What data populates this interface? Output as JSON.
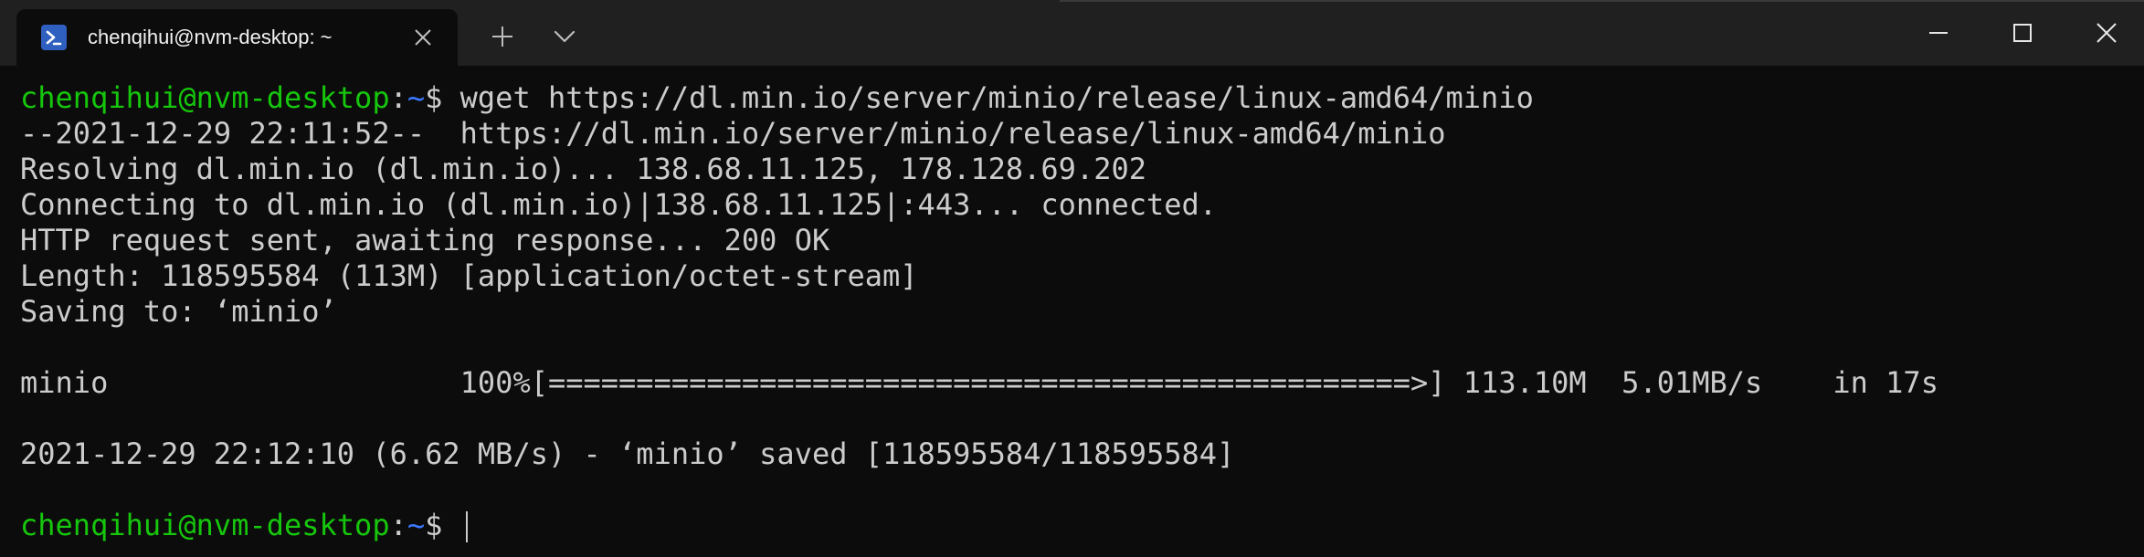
{
  "titlebar": {
    "tab_title": "chenqihui@nvm-desktop: ~",
    "tab_icon": "powershell-icon",
    "new_tab_icon": "plus-icon",
    "dropdown_icon": "chevron-down-icon",
    "minimize_icon": "minimize-icon",
    "maximize_icon": "maximize-icon",
    "close_icon": "close-icon"
  },
  "colors": {
    "prompt_user": "#16c60c",
    "prompt_path": "#3b78ff",
    "text": "#cccccc",
    "background": "#0c0c0c",
    "titlebar": "#202020"
  },
  "terminal": {
    "line1": {
      "user": "chenqihui@nvm-desktop",
      "colon": ":",
      "path": "~",
      "dollar": "$ ",
      "command": "wget https://dl.min.io/server/minio/release/linux-amd64/minio"
    },
    "line2": "--2021-12-29 22:11:52--  https://dl.min.io/server/minio/release/linux-amd64/minio",
    "line3": "Resolving dl.min.io (dl.min.io)... 138.68.11.125, 178.128.69.202",
    "line4": "Connecting to dl.min.io (dl.min.io)|138.68.11.125|:443... connected.",
    "line5": "HTTP request sent, awaiting response... 200 OK",
    "line6": "Length: 118595584 (113M) [application/octet-stream]",
    "line7": "Saving to: ‘minio’",
    "line8": "minio                    100%[=================================================>] 113.10M  5.01MB/s    in 17s",
    "line9": "2021-12-29 22:12:10 (6.62 MB/s) - ‘minio’ saved [118595584/118595584]",
    "line10": {
      "user": "chenqihui@nvm-desktop",
      "colon": ":",
      "path": "~",
      "dollar": "$ "
    }
  }
}
